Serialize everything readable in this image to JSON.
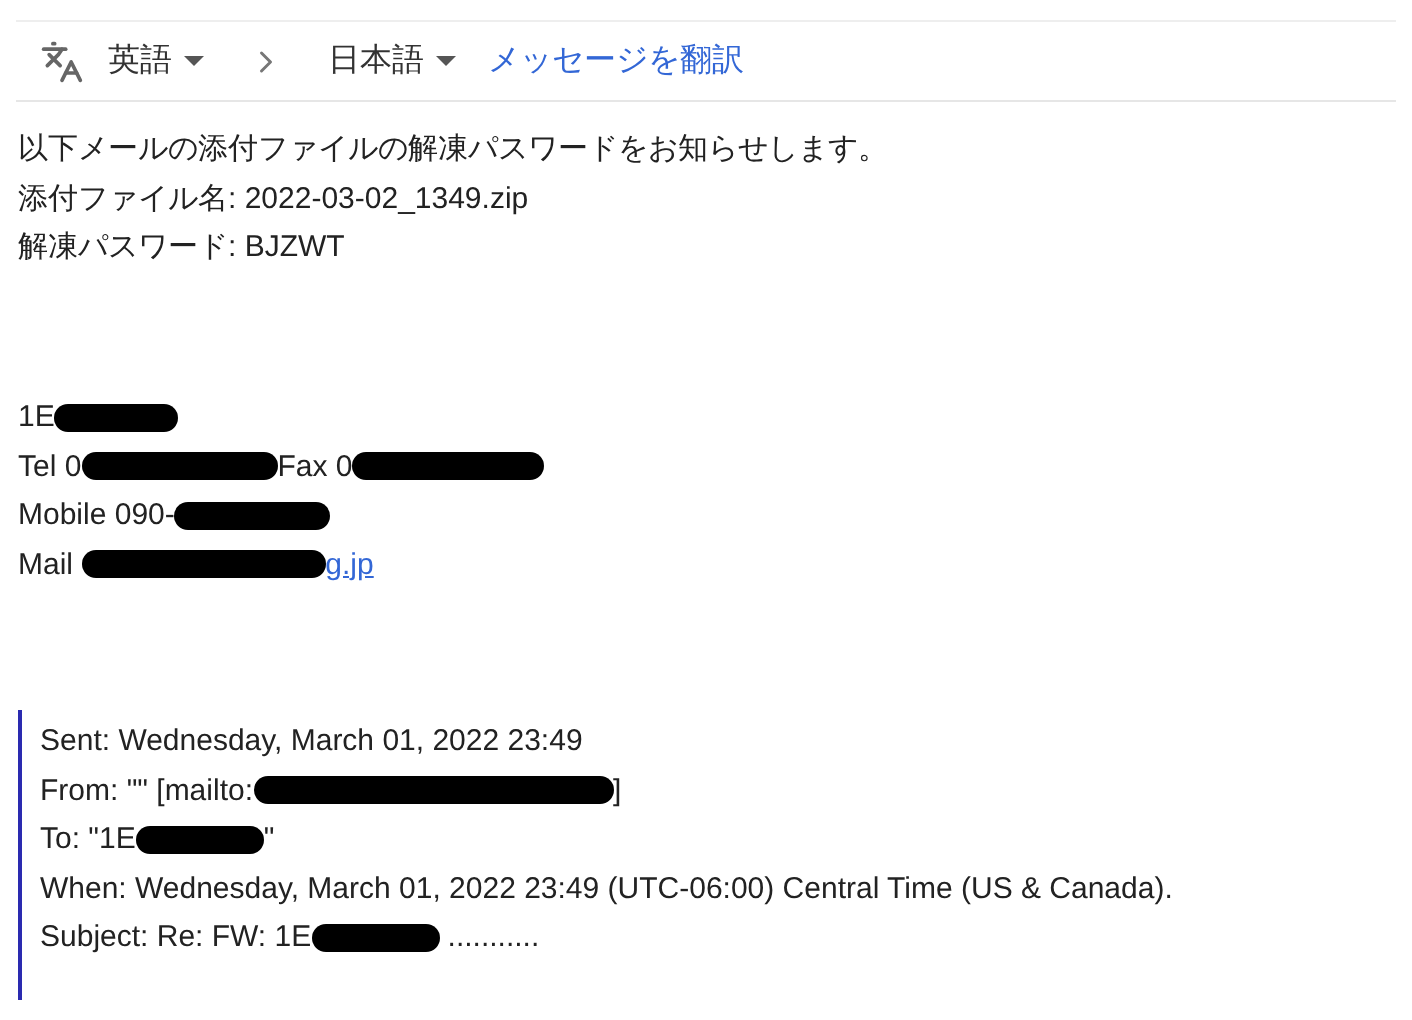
{
  "translate_bar": {
    "source_language": "英語",
    "target_language": "日本語",
    "translate_link": "メッセージを翻訳"
  },
  "message": [
    {
      "segments": [
        {
          "kind": "text",
          "text": "以下メールの添付ファイルの解凍パスワードをお知らせします。"
        }
      ]
    },
    {
      "segments": [
        {
          "kind": "text",
          "text": "添付ファイル名: 2022-03-02_1349.zip"
        }
      ]
    },
    {
      "segments": [
        {
          "kind": "text",
          "text": "解凍パスワード: BJZWT"
        }
      ]
    }
  ],
  "signature": [
    {
      "segments": [
        {
          "kind": "text",
          "text": "1E"
        },
        {
          "kind": "redacted"
        }
      ]
    },
    {
      "segments": [
        {
          "kind": "text",
          "text": "Tel 0"
        },
        {
          "kind": "redacted"
        },
        {
          "kind": "text",
          "text": "Fax 0"
        },
        {
          "kind": "redacted"
        }
      ]
    },
    {
      "segments": [
        {
          "kind": "text",
          "text": "Mobile 090-"
        },
        {
          "kind": "redacted"
        }
      ]
    },
    {
      "segments": [
        {
          "kind": "text",
          "text": "Mail "
        },
        {
          "kind": "redacted"
        },
        {
          "kind": "link",
          "text": "g.jp"
        }
      ]
    }
  ],
  "quoted": [
    {
      "segments": [
        {
          "kind": "text",
          "text": "Sent: Wednesday, March 01, 2022 23:49"
        }
      ]
    },
    {
      "segments": [
        {
          "kind": "text",
          "text": "From: \"\" [mailto:"
        },
        {
          "kind": "redacted"
        },
        {
          "kind": "text",
          "text": "]"
        }
      ]
    },
    {
      "segments": [
        {
          "kind": "text",
          "text": "To: \"1E"
        },
        {
          "kind": "redacted"
        },
        {
          "kind": "text",
          "text": "\""
        }
      ]
    },
    {
      "segments": [
        {
          "kind": "text",
          "text": "When: Wednesday, March 01, 2022 23:49 (UTC-06:00) Central Time (US & Canada)."
        }
      ]
    },
    {
      "segments": [
        {
          "kind": "text",
          "text": "Subject: Re: FW: 1E"
        },
        {
          "kind": "redacted"
        },
        {
          "kind": "text",
          "text": " ..........."
        }
      ]
    }
  ]
}
